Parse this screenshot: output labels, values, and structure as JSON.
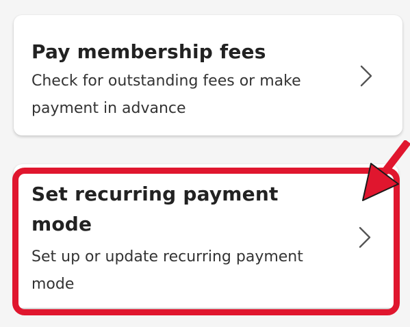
{
  "colors": {
    "background": "#f5f5f5",
    "card": "#ffffff",
    "highlight": "#e0162e",
    "title_text": "#222222",
    "desc_text": "#333333",
    "chevron": "#555555"
  },
  "items": [
    {
      "title": "Pay membership fees",
      "description": "Check for outstanding fees or make payment in advance",
      "icon": "chevron-right-icon"
    },
    {
      "title": "Set recurring payment mode",
      "description": "Set up or update recurring payment mode",
      "icon": "chevron-right-icon",
      "highlighted": true
    }
  ],
  "annotation": {
    "highlight_box": "red-highlight-box",
    "arrow": "red-arrow-icon"
  }
}
